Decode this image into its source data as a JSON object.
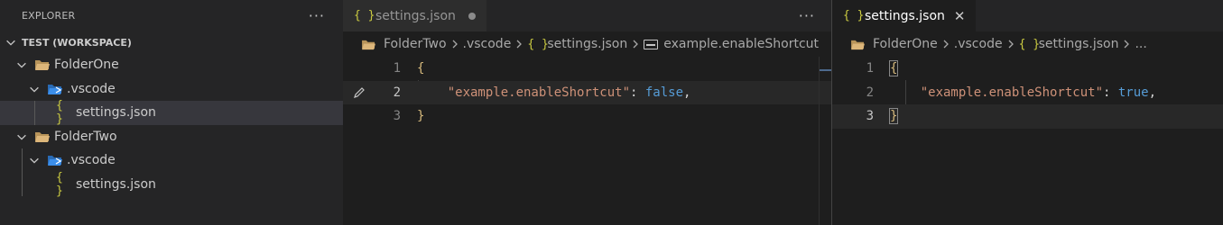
{
  "sidebar": {
    "title": "EXPLORER",
    "more_actions": "···",
    "workspace": "TEST (WORKSPACE)",
    "tree": [
      {
        "label": "FolderOne"
      },
      {
        "label": ".vscode"
      },
      {
        "label": "settings.json"
      },
      {
        "label": "FolderTwo"
      },
      {
        "label": ".vscode"
      },
      {
        "label": "settings.json"
      }
    ]
  },
  "editor_left": {
    "tab_label": "settings.json",
    "more_actions": "···",
    "breadcrumb": {
      "folder": "FolderTwo",
      "subfolder": ".vscode",
      "file": "settings.json",
      "symbol": "example.enableShortcut"
    },
    "lines": [
      {
        "num": "1",
        "open": "{"
      },
      {
        "num": "2",
        "key": "\"example.enableShortcut\"",
        "colon": ": ",
        "value": "false",
        "comma": ","
      },
      {
        "num": "3",
        "close": "}"
      }
    ]
  },
  "editor_right": {
    "tab_label": "settings.json",
    "close_glyph": "✕",
    "breadcrumb": {
      "folder": "FolderOne",
      "subfolder": ".vscode",
      "file": "settings.json",
      "more": "..."
    },
    "lines": [
      {
        "num": "1",
        "open": "{"
      },
      {
        "num": "2",
        "key": "\"example.enableShortcut\"",
        "colon": ": ",
        "value": "true",
        "comma": ","
      },
      {
        "num": "3",
        "close": "}"
      }
    ]
  },
  "icons": {
    "json": "{ }",
    "folder_color": "#dcb67a",
    "vscode_folder_color": "#3b8eea"
  }
}
